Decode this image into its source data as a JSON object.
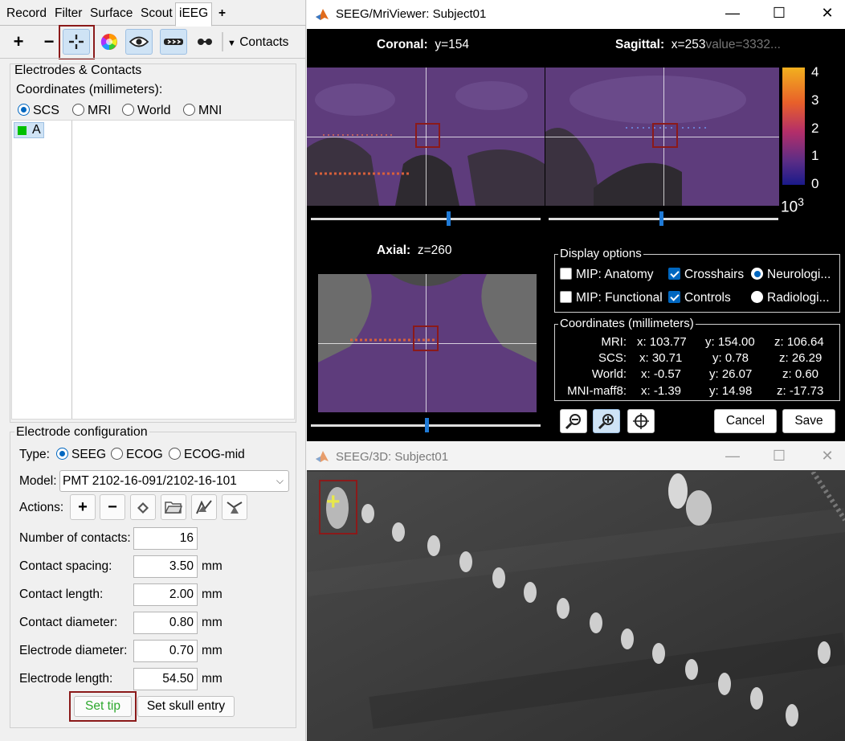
{
  "left_panel": {
    "tabs": [
      "Record",
      "Filter",
      "Surface",
      "Scout",
      "iEEG",
      "+"
    ],
    "active_tab": "iEEG",
    "toolbar": {
      "add_icon": "plus-icon",
      "remove_icon": "minus-icon",
      "crosshair_icon": "crosshair-icon",
      "color_icon": "color-wheel-icon",
      "eye_icon": "eye-icon",
      "arrows_icon": "electrode-arrows-icon",
      "dots_icon": "contacts-dots-icon",
      "contacts_menu": "Contacts"
    },
    "electrodes_title": "Electrodes & Contacts",
    "coordinates_label": "Coordinates (millimeters):",
    "coord_options": [
      "SCS",
      "MRI",
      "World",
      "MNI"
    ],
    "coord_selected": "SCS",
    "electrode_list": [
      {
        "name": "A",
        "color": "#00c000"
      }
    ],
    "config_title": "Electrode configuration",
    "type_label": "Type:",
    "type_options": [
      "SEEG",
      "ECOG",
      "ECOG-mid"
    ],
    "type_selected": "SEEG",
    "model_label": "Model:",
    "model_value": "PMT 2102-16-091/2102-16-101",
    "actions_label": "Actions:",
    "fields": [
      {
        "label": "Number of contacts:",
        "value": "16",
        "unit": ""
      },
      {
        "label": "Contact spacing:",
        "value": "3.50",
        "unit": "mm"
      },
      {
        "label": "Contact length:",
        "value": "2.00",
        "unit": "mm"
      },
      {
        "label": "Contact diameter:",
        "value": "0.80",
        "unit": "mm"
      },
      {
        "label": "Electrode diameter:",
        "value": "0.70",
        "unit": "mm"
      },
      {
        "label": "Electrode length:",
        "value": "54.50",
        "unit": "mm"
      }
    ],
    "set_tip": "Set tip",
    "set_skull_entry": "Set skull entry"
  },
  "mri_viewer": {
    "title": "SEEG/MriViewer: Subject01",
    "coronal_label": "Coronal:",
    "coronal_value": "y=154",
    "sagittal_label": "Sagittal:",
    "sagittal_value": "x=253",
    "sagittal_extra": "value=3332...",
    "axial_label": "Axial:",
    "axial_value": "z=260",
    "colorbar_ticks": [
      "4",
      "3",
      "2",
      "1",
      "0"
    ],
    "colorbar_exp_base": "10",
    "colorbar_exp": "3",
    "display_options_title": "Display options",
    "mip_anatomy": "MIP: Anatomy",
    "mip_functional": "MIP: Functional",
    "crosshairs": "Crosshairs",
    "controls": "Controls",
    "neurological": "Neurologi...",
    "radiological": "Radiologi...",
    "coords_title": "Coordinates (millimeters)",
    "coords": [
      {
        "label": "MRI:",
        "x": "x: 103.77",
        "y": "y: 154.00",
        "z": "z: 106.64"
      },
      {
        "label": "SCS:",
        "x": "x: 30.71",
        "y": "y: 0.78",
        "z": "z: 26.29"
      },
      {
        "label": "World:",
        "x": "x: -0.57",
        "y": "y: 26.07",
        "z": "z: 0.60"
      },
      {
        "label": "MNI-maff8:",
        "x": "x: -1.39",
        "y": "y: 14.98",
        "z": "z: -17.73"
      }
    ],
    "cancel": "Cancel",
    "save": "Save",
    "colors": {
      "overlay": "#5b3a78",
      "accent": "#0067c0",
      "highlight": "#8b1a1a"
    }
  },
  "viewer_3d": {
    "title": "SEEG/3D: Subject01"
  }
}
